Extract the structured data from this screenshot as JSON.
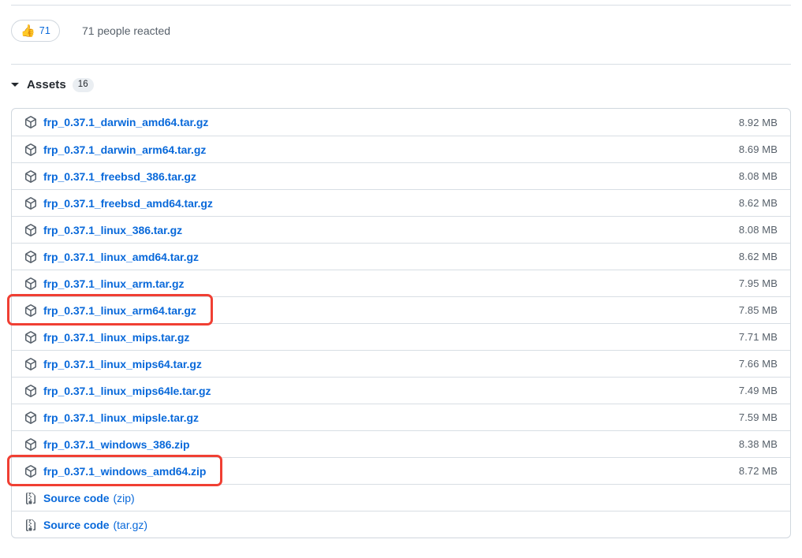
{
  "reactions": {
    "emoji": "thumbs-up-icon",
    "emoji_glyph": "👍",
    "count": "71",
    "summary": "71 people reacted"
  },
  "assets": {
    "title": "Assets",
    "count": "16",
    "caret": "caret-down-icon",
    "rows": [
      {
        "icon": "package-icon",
        "name": "frp_0.37.1_darwin_amd64.tar.gz",
        "suffix": "",
        "size": "8.92 MB",
        "highlighted": false
      },
      {
        "icon": "package-icon",
        "name": "frp_0.37.1_darwin_arm64.tar.gz",
        "suffix": "",
        "size": "8.69 MB",
        "highlighted": false
      },
      {
        "icon": "package-icon",
        "name": "frp_0.37.1_freebsd_386.tar.gz",
        "suffix": "",
        "size": "8.08 MB",
        "highlighted": false
      },
      {
        "icon": "package-icon",
        "name": "frp_0.37.1_freebsd_amd64.tar.gz",
        "suffix": "",
        "size": "8.62 MB",
        "highlighted": false
      },
      {
        "icon": "package-icon",
        "name": "frp_0.37.1_linux_386.tar.gz",
        "suffix": "",
        "size": "8.08 MB",
        "highlighted": false
      },
      {
        "icon": "package-icon",
        "name": "frp_0.37.1_linux_amd64.tar.gz",
        "suffix": "",
        "size": "8.62 MB",
        "highlighted": false
      },
      {
        "icon": "package-icon",
        "name": "frp_0.37.1_linux_arm.tar.gz",
        "suffix": "",
        "size": "7.95 MB",
        "highlighted": false
      },
      {
        "icon": "package-icon",
        "name": "frp_0.37.1_linux_arm64.tar.gz",
        "suffix": "",
        "size": "7.85 MB",
        "highlighted": true
      },
      {
        "icon": "package-icon",
        "name": "frp_0.37.1_linux_mips.tar.gz",
        "suffix": "",
        "size": "7.71 MB",
        "highlighted": false
      },
      {
        "icon": "package-icon",
        "name": "frp_0.37.1_linux_mips64.tar.gz",
        "suffix": "",
        "size": "7.66 MB",
        "highlighted": false
      },
      {
        "icon": "package-icon",
        "name": "frp_0.37.1_linux_mips64le.tar.gz",
        "suffix": "",
        "size": "7.49 MB",
        "highlighted": false
      },
      {
        "icon": "package-icon",
        "name": "frp_0.37.1_linux_mipsle.tar.gz",
        "suffix": "",
        "size": "7.59 MB",
        "highlighted": false
      },
      {
        "icon": "package-icon",
        "name": "frp_0.37.1_windows_386.zip",
        "suffix": "",
        "size": "8.38 MB",
        "highlighted": false
      },
      {
        "icon": "package-icon",
        "name": "frp_0.37.1_windows_amd64.zip",
        "suffix": "",
        "size": "8.72 MB",
        "highlighted": true
      },
      {
        "icon": "file-zip-icon",
        "name": "Source code",
        "suffix": "(zip)",
        "size": "",
        "highlighted": false
      },
      {
        "icon": "file-zip-icon",
        "name": "Source code",
        "suffix": "(tar.gz)",
        "size": "",
        "highlighted": false
      }
    ]
  },
  "colors": {
    "link": "#0969da",
    "muted": "#57606a",
    "border": "#d0d7de",
    "row_border": "#d8dee4",
    "highlight": "#f03f33",
    "badge_bg": "#eaeef2"
  }
}
